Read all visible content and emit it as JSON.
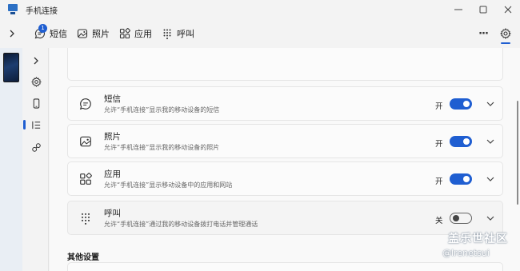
{
  "window": {
    "title": "手机连接",
    "controls": [
      "minimize",
      "maximize",
      "close"
    ]
  },
  "topnav": {
    "tabs": [
      {
        "label": "短信",
        "icon": "message-icon",
        "badge": "1"
      },
      {
        "label": "照片",
        "icon": "photo-icon"
      },
      {
        "label": "应用",
        "icon": "apps-icon"
      },
      {
        "label": "呼叫",
        "icon": "dialpad-icon"
      }
    ],
    "more": "···"
  },
  "rail": {
    "items": [
      "expand-icon",
      "gear-icon",
      "phone-icon",
      "list-icon",
      "link-icon"
    ],
    "active": "list-icon"
  },
  "features": [
    {
      "title": "短信",
      "desc": "允许“手机连接”显示我的移动设备的短信",
      "state": "开",
      "on": true,
      "icon": "message-icon"
    },
    {
      "title": "照片",
      "desc": "允许“手机连接”显示我的移动设备的照片",
      "state": "开",
      "on": true,
      "icon": "photo-icon"
    },
    {
      "title": "应用",
      "desc": "允许“手机连接”显示移动设备中的应用和网站",
      "state": "开",
      "on": true,
      "icon": "apps-icon"
    },
    {
      "title": "呼叫",
      "desc": "允许“手机连接”通过我的移动设备拨打电话并管理通话",
      "state": "关",
      "on": false,
      "icon": "dialpad-icon"
    }
  ],
  "section": {
    "heading": "其他设置"
  },
  "watermark": {
    "logo": "盖乐世社区",
    "handle": "@lrenetsui"
  },
  "colors": {
    "accent": "#1f5ed1",
    "background": "#f3f3f3",
    "card": "#fbfbfb"
  }
}
